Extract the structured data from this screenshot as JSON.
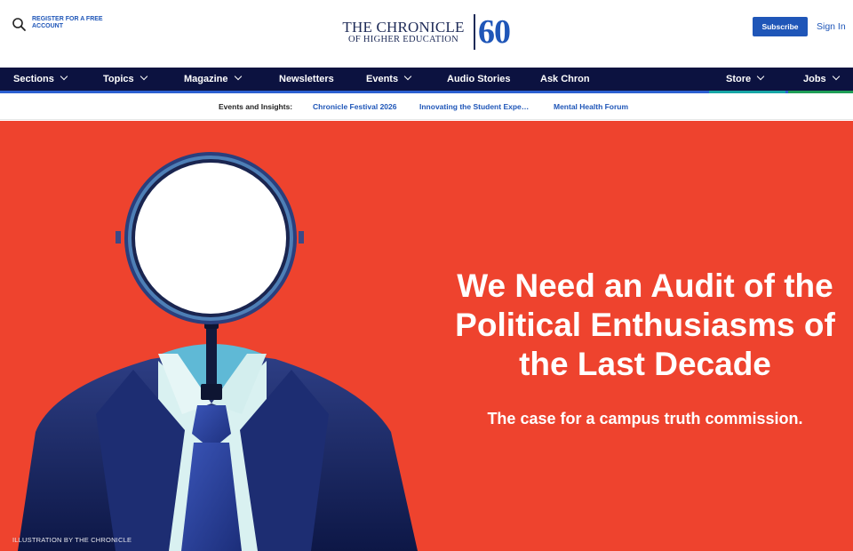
{
  "header": {
    "register_label": "REGISTER FOR A FREE ACCOUNT",
    "logo_line1": "THE CHRONICLE",
    "logo_line2": "OF HIGHER EDUCATION",
    "logo_anniversary": "60",
    "subscribe_label": "Subscribe",
    "signin_label": "Sign In"
  },
  "nav": {
    "items": [
      {
        "label": "Sections",
        "dropdown": true
      },
      {
        "label": "Topics",
        "dropdown": true
      },
      {
        "label": "Magazine",
        "dropdown": true
      },
      {
        "label": "Newsletters",
        "dropdown": false
      },
      {
        "label": "Events",
        "dropdown": true
      },
      {
        "label": "Audio Stories",
        "dropdown": false
      },
      {
        "label": "Ask Chron",
        "dropdown": false
      },
      {
        "label": "Store",
        "dropdown": true
      },
      {
        "label": "Jobs",
        "dropdown": true
      }
    ]
  },
  "events_bar": {
    "label": "Events and Insights:",
    "links": [
      "Chronicle Festival 2026",
      "Innovating the Student Expe…",
      "Mental Health Forum"
    ]
  },
  "hero": {
    "headline": "We Need an Audit of the Political Enthusiasms of the Last Decade",
    "dek": "The case for a campus truth commission.",
    "credit": "ILLUSTRATION BY THE CHRONICLE"
  },
  "colors": {
    "brand_blue": "#1f56b8",
    "nav_bg": "#0c1240",
    "hero_bg": "#ee432e"
  }
}
